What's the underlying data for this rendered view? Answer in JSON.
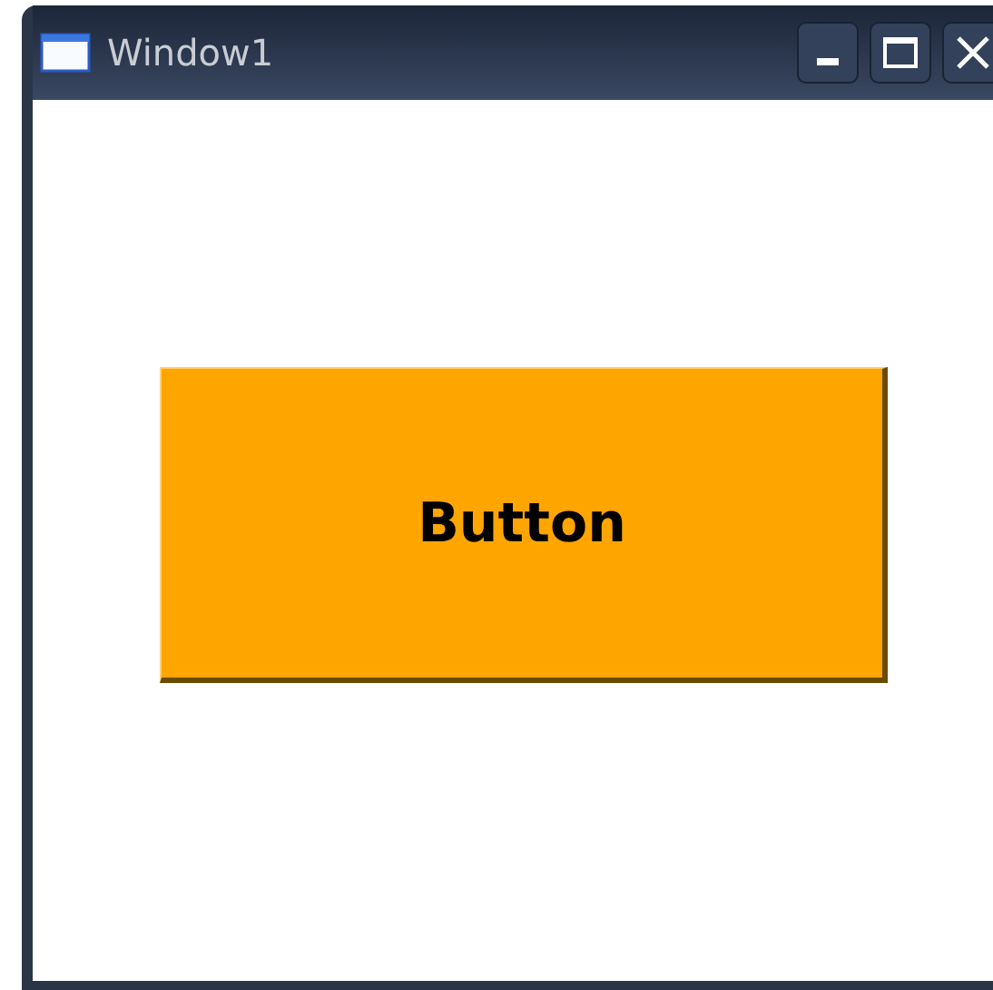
{
  "window": {
    "title": "Window1"
  },
  "button": {
    "label": "Button"
  }
}
